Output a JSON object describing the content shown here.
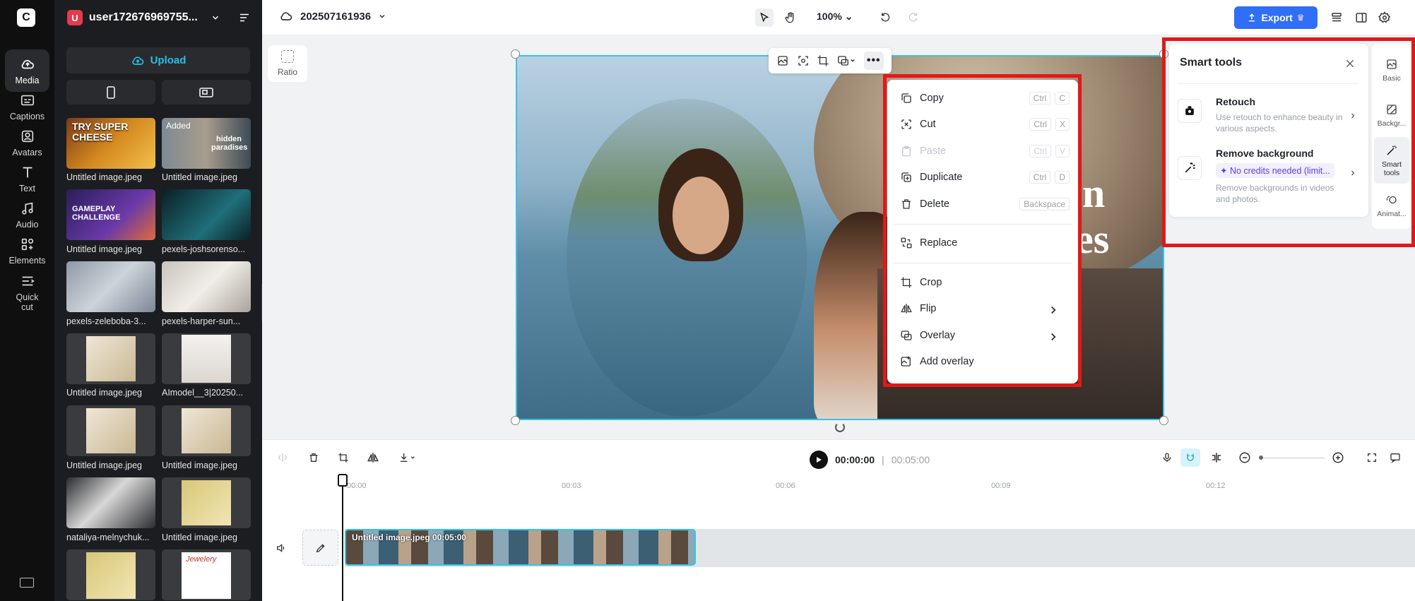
{
  "rail": {
    "items": [
      {
        "label": "Media"
      },
      {
        "label": "Captions"
      },
      {
        "label": "Avatars"
      },
      {
        "label": "Text"
      },
      {
        "label": "Audio"
      },
      {
        "label": "Elements"
      },
      {
        "label": "Quick cut"
      }
    ]
  },
  "media": {
    "avatar_letter": "U",
    "username": "user172676969755...",
    "upload_label": "Upload",
    "added_badge": "Added",
    "items": [
      {
        "label": "Untitled image.jpeg",
        "thumb_text": "TRY SUPER CHEESE"
      },
      {
        "label": "Untitled image.jpeg",
        "thumb_text": "hidden paradises"
      },
      {
        "label": "Untitled image.jpeg",
        "thumb_text": "GAMEPLAY CHALLENGE"
      },
      {
        "label": "pexels-joshsorenso...",
        "thumb_text": ""
      },
      {
        "label": "pexels-zeleboba-3...",
        "thumb_text": ""
      },
      {
        "label": "pexels-harper-sun...",
        "thumb_text": ""
      },
      {
        "label": "Untitled image.jpeg",
        "thumb_text": ""
      },
      {
        "label": "AImodel__3|20250...",
        "thumb_text": ""
      },
      {
        "label": "Untitled image.jpeg",
        "thumb_text": ""
      },
      {
        "label": "Untitled image.jpeg",
        "thumb_text": ""
      },
      {
        "label": "nataliya-melnychuk...",
        "thumb_text": ""
      },
      {
        "label": "Untitled image.jpeg",
        "thumb_text": ""
      },
      {
        "label": "",
        "thumb_text": ""
      },
      {
        "label": "",
        "thumb_text": "Jewelery"
      }
    ]
  },
  "topbar": {
    "project_name": "202507161936",
    "zoom": "100%",
    "export_label": "Export"
  },
  "canvas": {
    "ratio_label": "Ratio",
    "overlay_text_1": "n",
    "overlay_text_2": "es"
  },
  "context_menu": {
    "items": [
      {
        "label": "Copy",
        "keys": [
          "Ctrl",
          "C"
        ]
      },
      {
        "label": "Cut",
        "keys": [
          "Ctrl",
          "X"
        ]
      },
      {
        "label": "Paste",
        "keys": [
          "Ctrl",
          "V"
        ]
      },
      {
        "label": "Duplicate",
        "keys": [
          "Ctrl",
          "D"
        ]
      },
      {
        "label": "Delete",
        "keys": [
          "Backspace"
        ]
      },
      {
        "label": "Replace"
      },
      {
        "label": "Crop"
      },
      {
        "label": "Flip"
      },
      {
        "label": "Overlay"
      },
      {
        "label": "Add overlay"
      }
    ]
  },
  "smart_tools": {
    "title": "Smart tools",
    "retouch": {
      "name": "Retouch",
      "desc": "Use retouch to enhance beauty in various aspects."
    },
    "remove_bg": {
      "name": "Remove background",
      "credit": "✦ No credits needed (limit...",
      "desc": "Remove backgrounds in videos and photos."
    }
  },
  "right_tabs": [
    {
      "label": "Basic"
    },
    {
      "label": "Backgr..."
    },
    {
      "label": "Smart tools"
    },
    {
      "label": "Animat..."
    }
  ],
  "timeline": {
    "current_time": "00:00:00",
    "divider": "|",
    "duration": "00:05:00",
    "ruler": [
      "00:00",
      "00:03",
      "00:06",
      "00:09",
      "00:12"
    ],
    "clip_label": "Untitled image.jpeg   00:05:00"
  }
}
